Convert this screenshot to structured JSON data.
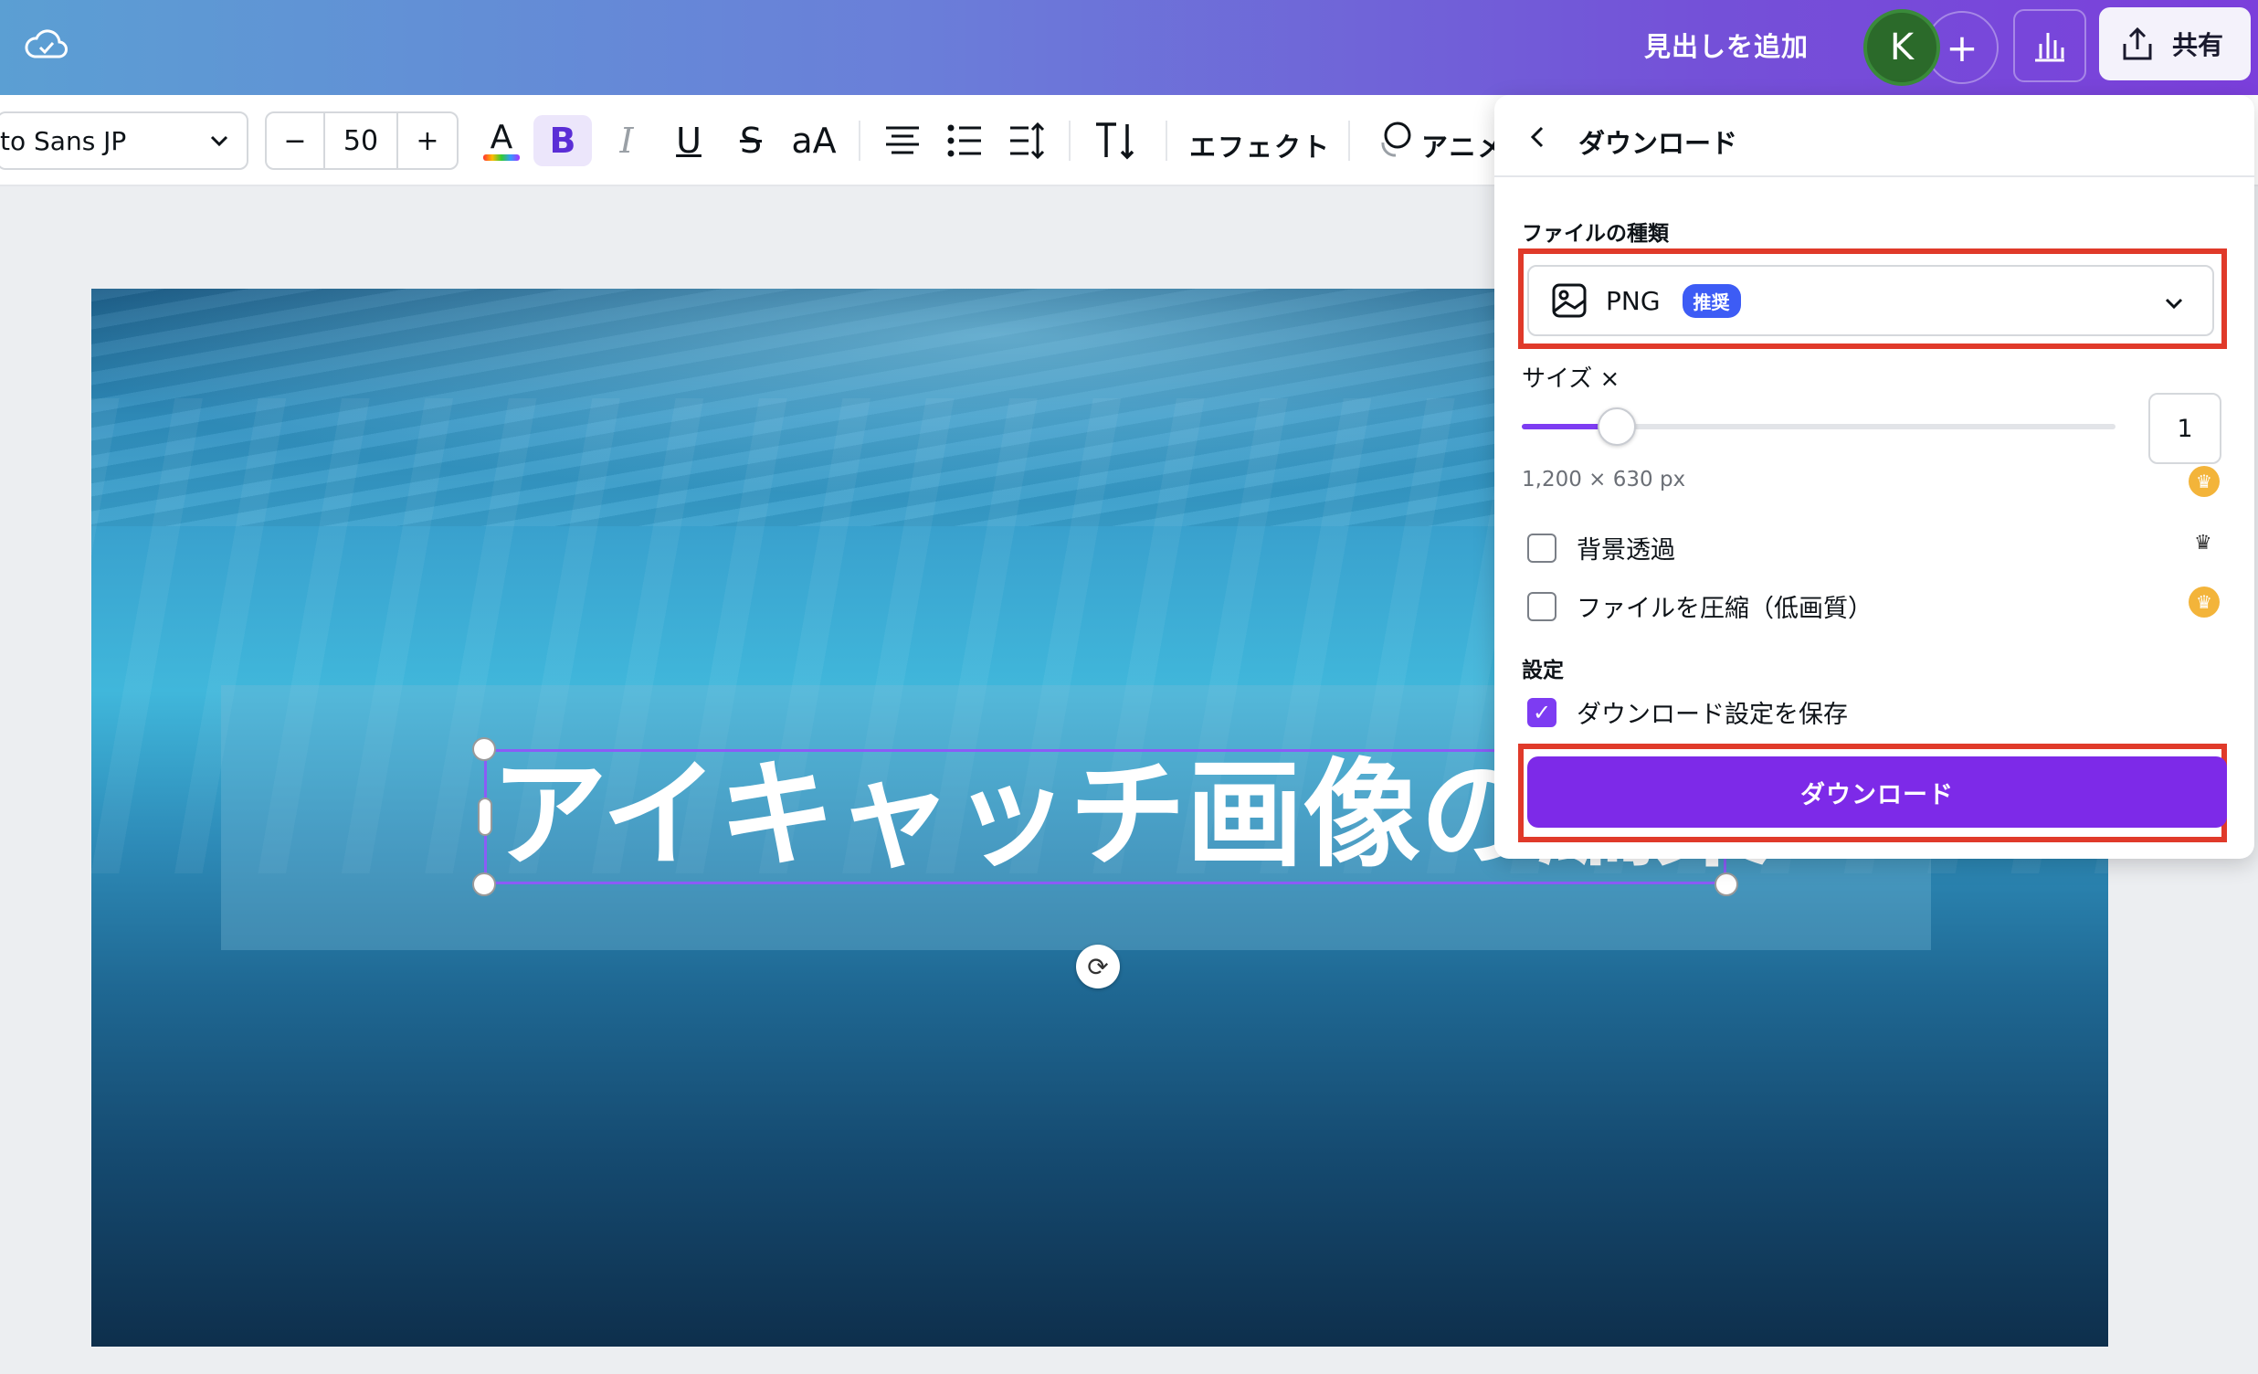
{
  "topbar": {
    "add_heading": "見出しを追加",
    "avatar_initial": "K",
    "plus": "+",
    "share_label": "共有"
  },
  "toolbar": {
    "font_name": "to Sans JP",
    "font_size_minus": "−",
    "font_size": "50",
    "font_size_plus": "+",
    "text_color_glyph": "A",
    "bold_glyph": "B",
    "italic_glyph": "I",
    "underline_glyph": "U",
    "strike_glyph": "S",
    "case_glyph": "aA",
    "effect_label": "エフェクト",
    "animate_label": "アニメ"
  },
  "canvas": {
    "headline": "アイキャッチ画像の編集"
  },
  "download_panel": {
    "title": "ダウンロード",
    "file_type_label": "ファイルの種類",
    "file_type_value": "PNG",
    "recommended_badge": "推奨",
    "size_label": "サイズ ×",
    "size_value": "1",
    "size_fraction": 0.16,
    "dimensions": "1,200 × 630 px",
    "transparent_bg_label": "背景透過",
    "transparent_bg_checked": false,
    "compress_label": "ファイルを圧縮（低画質）",
    "compress_checked": false,
    "settings_label": "設定",
    "save_settings_label": "ダウンロード設定を保存",
    "save_settings_checked": true,
    "download_button": "ダウンロード"
  },
  "colors": {
    "accent": "#7d2ae8",
    "highlight_box": "#e03a2a",
    "badge": "#3d5cf5",
    "crown": "#f3b43a"
  }
}
